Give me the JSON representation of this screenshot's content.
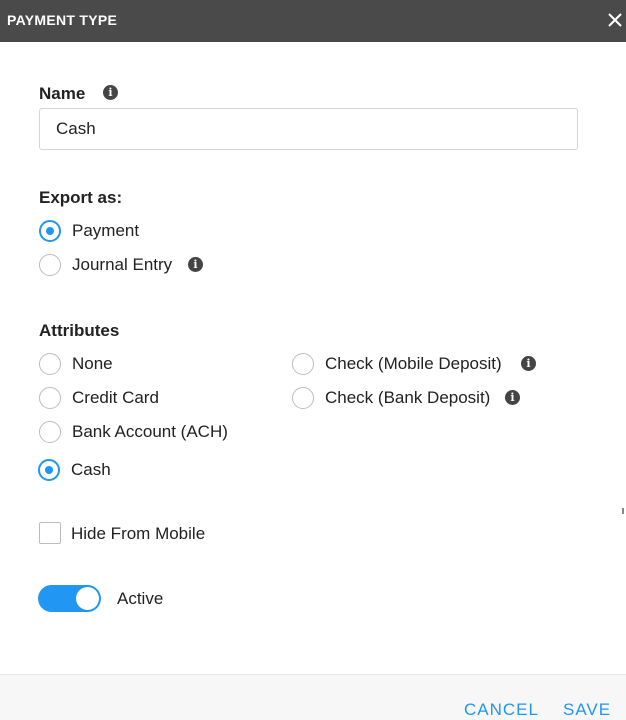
{
  "dialog": {
    "title": "PAYMENT TYPE",
    "close_icon": "close-icon"
  },
  "name_field": {
    "label": "Name",
    "value": "Cash",
    "info_icon": "info-icon"
  },
  "export_as": {
    "label": "Export as:",
    "options": [
      {
        "label": "Payment",
        "checked": true
      },
      {
        "label": "Journal Entry",
        "checked": false,
        "info_icon": "info-icon"
      }
    ]
  },
  "attributes": {
    "label": "Attributes",
    "options": [
      {
        "label": "None",
        "checked": false
      },
      {
        "label": "Credit Card",
        "checked": false
      },
      {
        "label": "Bank Account (ACH)",
        "checked": false
      },
      {
        "label": "Cash",
        "checked": true
      },
      {
        "label": "Check (Mobile Deposit)",
        "checked": false,
        "info_icon": "info-icon"
      },
      {
        "label": "Check (Bank Deposit)",
        "checked": false,
        "info_icon": "info-icon"
      }
    ]
  },
  "hide_from_mobile": {
    "label": "Hide From Mobile",
    "checked": false
  },
  "active_toggle": {
    "label": "Active",
    "on": true
  },
  "footer": {
    "cancel_label": "CANCEL",
    "save_label": "SAVE"
  },
  "colors": {
    "header_bg": "#4a4a4a",
    "accent": "#2196f3"
  }
}
